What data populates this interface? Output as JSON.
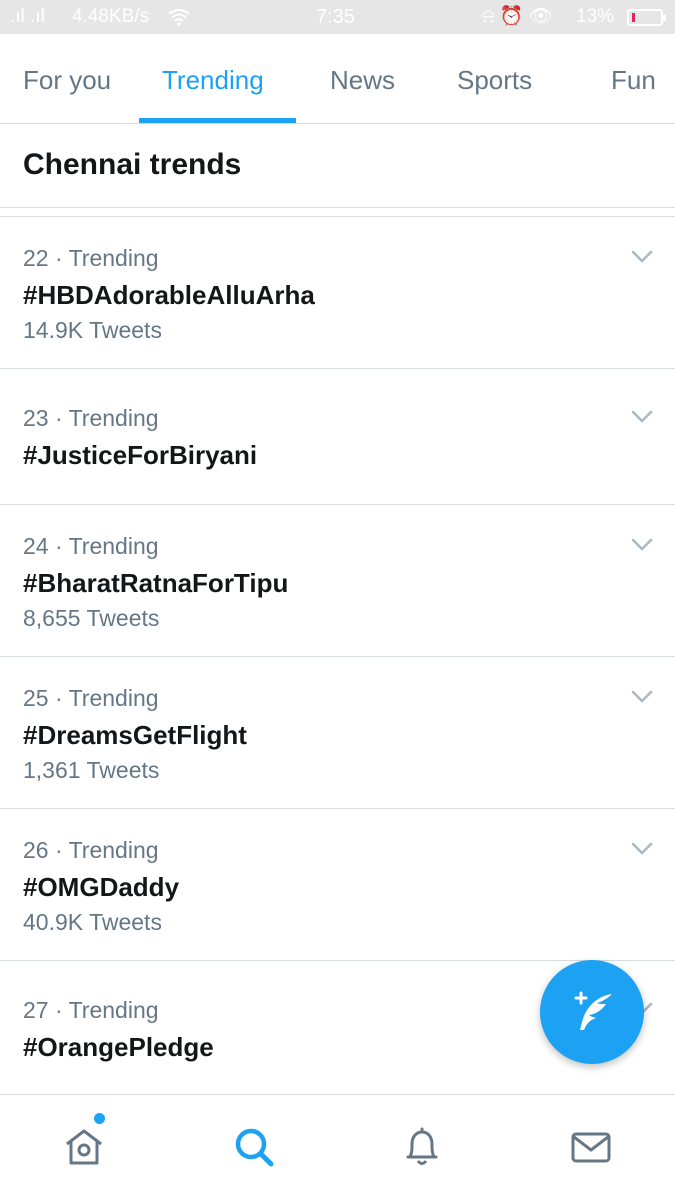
{
  "status_bar": {
    "signal": ".ıl .ıl",
    "speed": "4.48KB/s",
    "time": "7:35",
    "icons": "⍾ ⏰ 👁",
    "battery": "13%"
  },
  "tabs": [
    {
      "label": "For you"
    },
    {
      "label": "Trending"
    },
    {
      "label": "News"
    },
    {
      "label": "Sports"
    },
    {
      "label": "Fun"
    }
  ],
  "section": {
    "title": "Chennai trends"
  },
  "trends": [
    {
      "meta": "22 · Trending",
      "name": "#HBDAdorableAlluArha",
      "count": "14.9K Tweets"
    },
    {
      "meta": "23 · Trending",
      "name": "#JusticeForBiryani",
      "count": ""
    },
    {
      "meta": "24 · Trending",
      "name": "#BharatRatnaForTipu",
      "count": "8,655 Tweets"
    },
    {
      "meta": "25 · Trending",
      "name": "#DreamsGetFlight",
      "count": "1,361 Tweets"
    },
    {
      "meta": "26 · Trending",
      "name": "#OMGDaddy",
      "count": "40.9K Tweets"
    },
    {
      "meta": "27 · Trending",
      "name": "#OrangePledge",
      "count": ""
    }
  ],
  "colors": {
    "accent": "#1da1f2",
    "muted": "#657786",
    "text": "#14171a"
  },
  "icons": {
    "fab": "compose-tweet-icon",
    "nav": [
      "home-icon",
      "search-icon",
      "notifications-bell-icon",
      "messages-envelope-icon"
    ]
  }
}
